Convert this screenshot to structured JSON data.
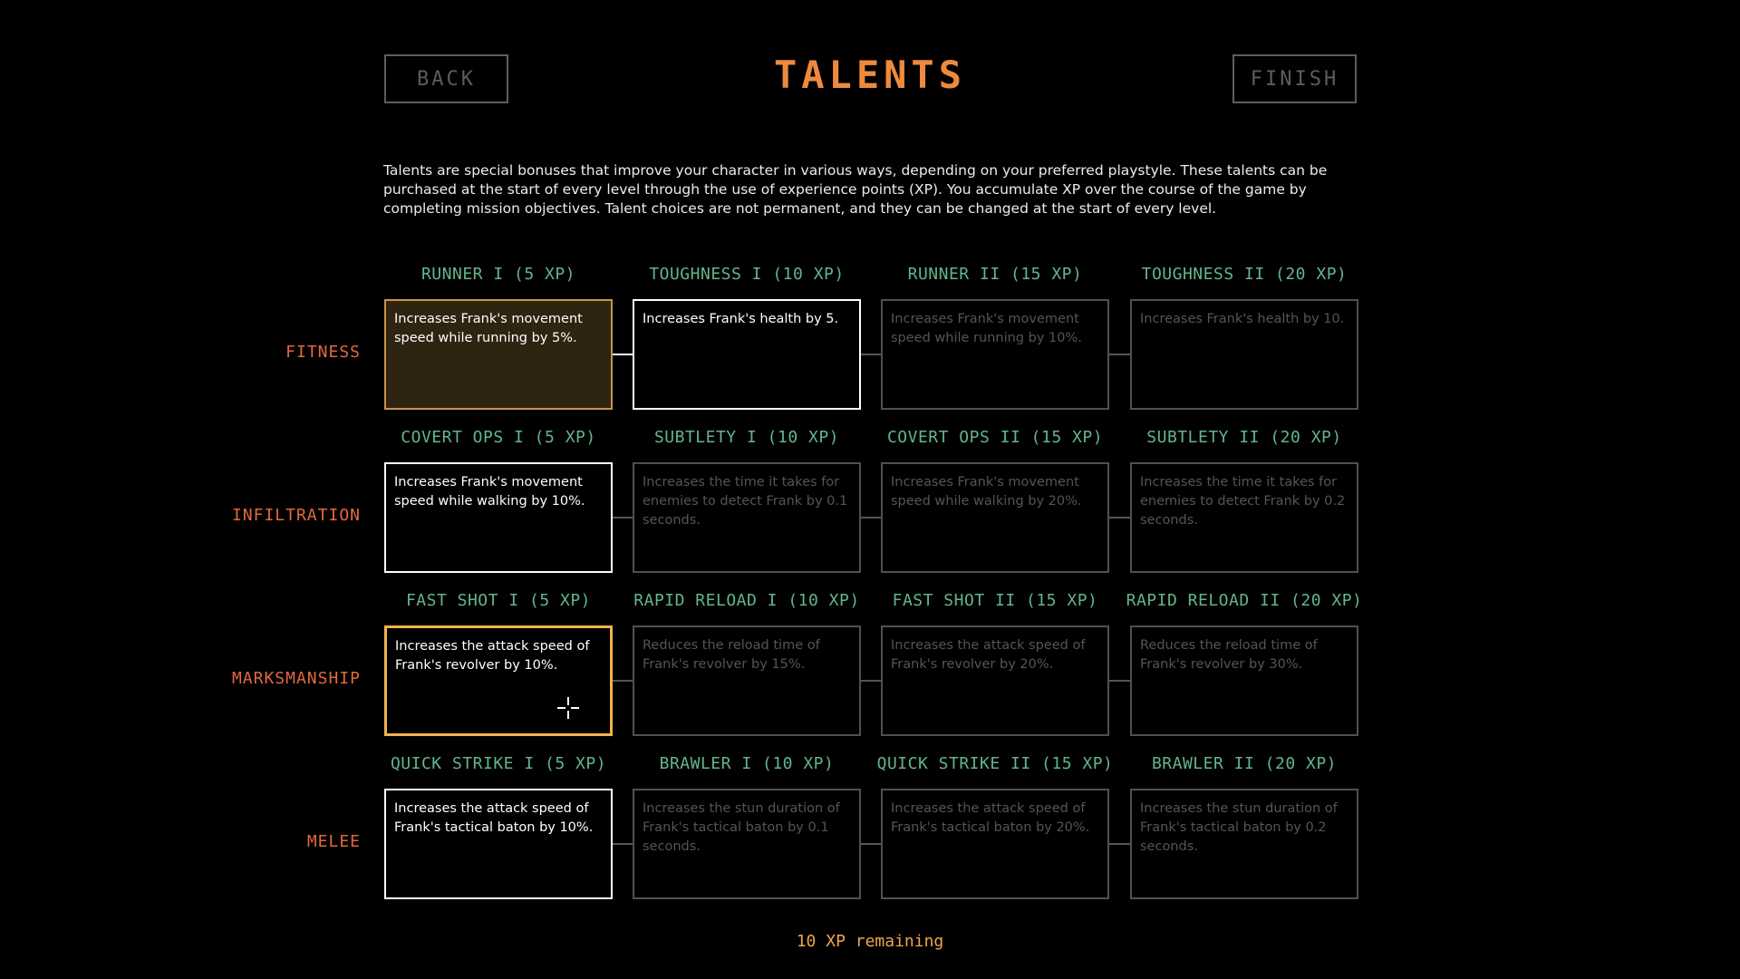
{
  "header": {
    "back_label": "BACK",
    "title": "TALENTS",
    "finish_label": "FINISH"
  },
  "intro_text": "Talents are special bonuses that improve your character in various ways, depending on your preferred playstyle. These talents can be purchased at the start of every level through the use of experience points (XP). You accumulate XP over the course of the game by completing mission objectives. Talent choices are not permanent, and they can be changed at the start of every level.",
  "rows": [
    {
      "label": "FITNESS",
      "talents": [
        {
          "title": "RUNNER I (5 XP)",
          "desc": "Increases Frank's movement speed while running by 5%.",
          "state": "purchased"
        },
        {
          "title": "TOUGHNESS I (10 XP)",
          "desc": "Increases Frank's health by 5.",
          "state": "available"
        },
        {
          "title": "RUNNER II (15 XP)",
          "desc": "Increases Frank's movement speed while running by 10%.",
          "state": "locked"
        },
        {
          "title": "TOUGHNESS II (20 XP)",
          "desc": "Increases Frank's health by 10.",
          "state": "locked"
        }
      ]
    },
    {
      "label": "INFILTRATION",
      "talents": [
        {
          "title": "COVERT OPS I (5 XP)",
          "desc": "Increases Frank's movement speed while walking by 10%.",
          "state": "available"
        },
        {
          "title": "SUBTLETY I (10 XP)",
          "desc": "Increases the time it takes for enemies to detect Frank by 0.1 seconds.",
          "state": "locked"
        },
        {
          "title": "COVERT OPS II (15 XP)",
          "desc": "Increases Frank's movement speed while walking by 20%.",
          "state": "locked"
        },
        {
          "title": "SUBTLETY II (20 XP)",
          "desc": "Increases the time it takes for enemies to detect Frank by 0.2 seconds.",
          "state": "locked"
        }
      ]
    },
    {
      "label": "MARKSMANSHIP",
      "talents": [
        {
          "title": "FAST SHOT I (5 XP)",
          "desc": "Increases the attack speed of Frank's revolver by 10%.",
          "state": "hovered"
        },
        {
          "title": "RAPID RELOAD I (10 XP)",
          "desc": "Reduces the reload time of Frank's revolver by 15%.",
          "state": "locked"
        },
        {
          "title": "FAST SHOT II (15 XP)",
          "desc": "Increases the attack speed of Frank's revolver by 20%.",
          "state": "locked"
        },
        {
          "title": "RAPID RELOAD II (20 XP)",
          "desc": "Reduces the reload time of Frank's revolver by 30%.",
          "state": "locked"
        }
      ]
    },
    {
      "label": "MELEE",
      "talents": [
        {
          "title": "QUICK STRIKE I (5 XP)",
          "desc": "Increases the attack speed of Frank's tactical baton by 10%.",
          "state": "available"
        },
        {
          "title": "BRAWLER I (10 XP)",
          "desc": "Increases the stun duration of Frank's tactical baton by 0.1 seconds.",
          "state": "locked"
        },
        {
          "title": "QUICK STRIKE II (15 XP)",
          "desc": "Increases the attack speed of Frank's tactical baton by 20%.",
          "state": "locked"
        },
        {
          "title": "BRAWLER II (20 XP)",
          "desc": "Increases the stun duration of Frank's tactical baton by 0.2 seconds.",
          "state": "locked"
        }
      ]
    }
  ],
  "footer": {
    "xp_remaining": "10 XP remaining"
  },
  "colors": {
    "title": "#ee8a3e",
    "row_label": "#e2683e",
    "talent_title": "#62b58c",
    "purchased_border": "#c8954a",
    "hover_border": "#f1b24f",
    "xp_text": "#f0a44e"
  }
}
